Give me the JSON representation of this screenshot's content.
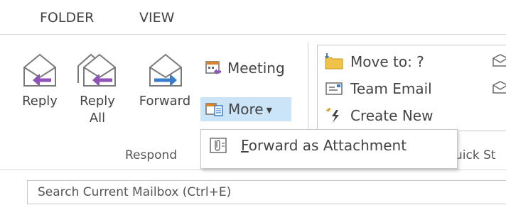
{
  "tabs": [
    {
      "label": "FOLDER"
    },
    {
      "label": "VIEW"
    }
  ],
  "respond": {
    "reply_label": "Reply",
    "reply_all_line1": "Reply",
    "reply_all_line2": "All",
    "forward_label": "Forward",
    "meeting_label": "Meeting",
    "more_label": "More",
    "group_label": "Respond"
  },
  "quick_steps": {
    "items": [
      {
        "label": "Move to: ?",
        "icon": "folder-move-icon"
      },
      {
        "label": "Team Email",
        "icon": "team-email-icon"
      },
      {
        "label": "Create New",
        "icon": "create-new-icon"
      }
    ],
    "group_label_partial": "uick St"
  },
  "dropdown": {
    "items": [
      {
        "mnemonic": "F",
        "rest": "orward as Attachment",
        "icon": "paperclip-attachment-icon"
      }
    ]
  },
  "search": {
    "placeholder": "Search Current Mailbox (Ctrl+E)"
  },
  "colors": {
    "reply_arrow": "#8e52b8",
    "forward_arrow": "#3b7dc8",
    "hover_bg": "#cce4f7"
  }
}
